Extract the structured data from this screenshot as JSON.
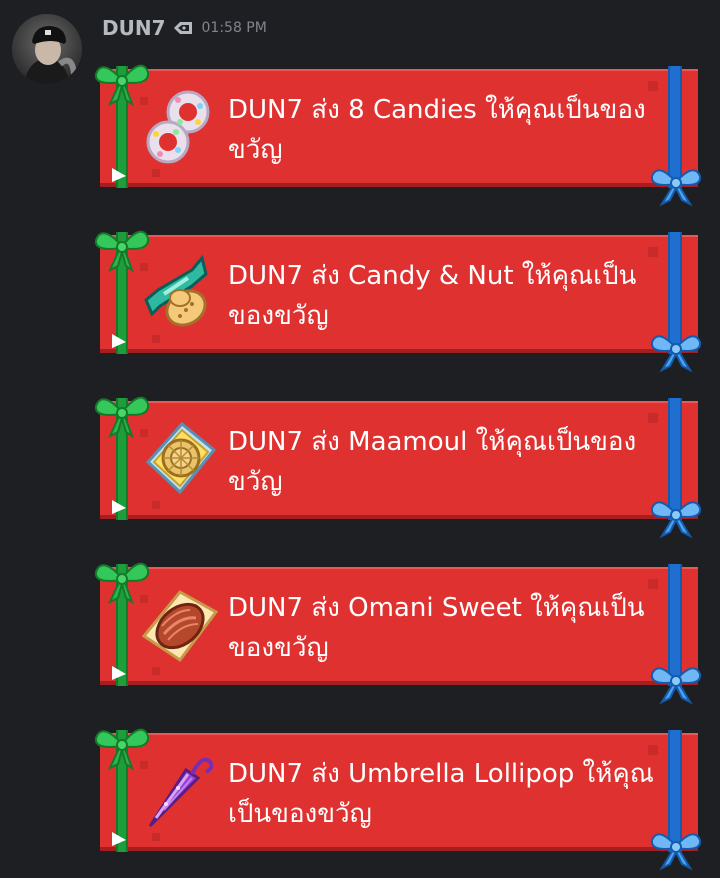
{
  "message": {
    "username": "DUN7",
    "timestamp": "01:58 PM",
    "badge_icon": "badge-icon",
    "avatar_icon": "avatar"
  },
  "gifts": [
    {
      "text": "DUN7 ส่ง 8 Candies ให้คุณเป็นของขวัญ",
      "icon": "candies-icon"
    },
    {
      "text": "DUN7 ส่ง Candy & Nut ให้คุณเป็นของขวัญ",
      "icon": "candy-nut-icon"
    },
    {
      "text": "DUN7 ส่ง Maamoul ให้คุณเป็นของขวัญ",
      "icon": "maamoul-icon"
    },
    {
      "text": "DUN7 ส่ง Omani Sweet ให้คุณเป็นของขวัญ",
      "icon": "omani-sweet-icon"
    },
    {
      "text": "DUN7 ส่ง Umbrella Lollipop ให้คุณเป็นของขวัญ",
      "icon": "umbrella-lollipop-icon"
    }
  ],
  "colors": {
    "background": "#1e1f22",
    "card_red": "#e03131",
    "ribbon_green": "#1e9e3a",
    "ribbon_blue": "#1f6fd1",
    "username": "#b5bac1",
    "timestamp": "#80848e"
  }
}
